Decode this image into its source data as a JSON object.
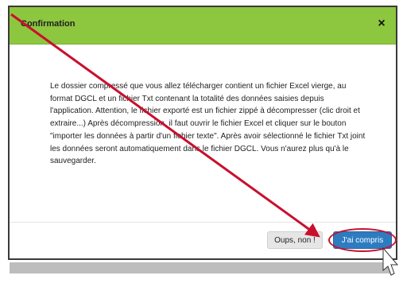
{
  "dialog": {
    "title": "Confirmation",
    "close_label": "×",
    "message": "Le dossier compressé que vous allez télécharger contient un fichier Excel vierge, au format DGCL et un fichier Txt contenant la totalité des données saisies depuis l'application. Attention, le fichier exporté est un fichier zippé à décompresser (clic droit et extraire...) Après décompression, il faut ouvrir le fichier Excel et cliquer sur le bouton \"importer les données à partir d'un fichier texte\". Après avoir sélectionné le fichier Txt joint les données seront automatiquement dans le fichier DGCL. Vous n'aurez plus qu'à le sauvegarder.",
    "cancel_label": "Oups, non !",
    "confirm_label": "J'ai compris"
  },
  "colors": {
    "header": "#8dc63f",
    "confirm": "#2d7cc1",
    "annotation": "#c8102e"
  },
  "icons": {
    "close": "close-icon",
    "arrow": "arrow-annotation",
    "cursor": "mouse-pointer-icon"
  }
}
